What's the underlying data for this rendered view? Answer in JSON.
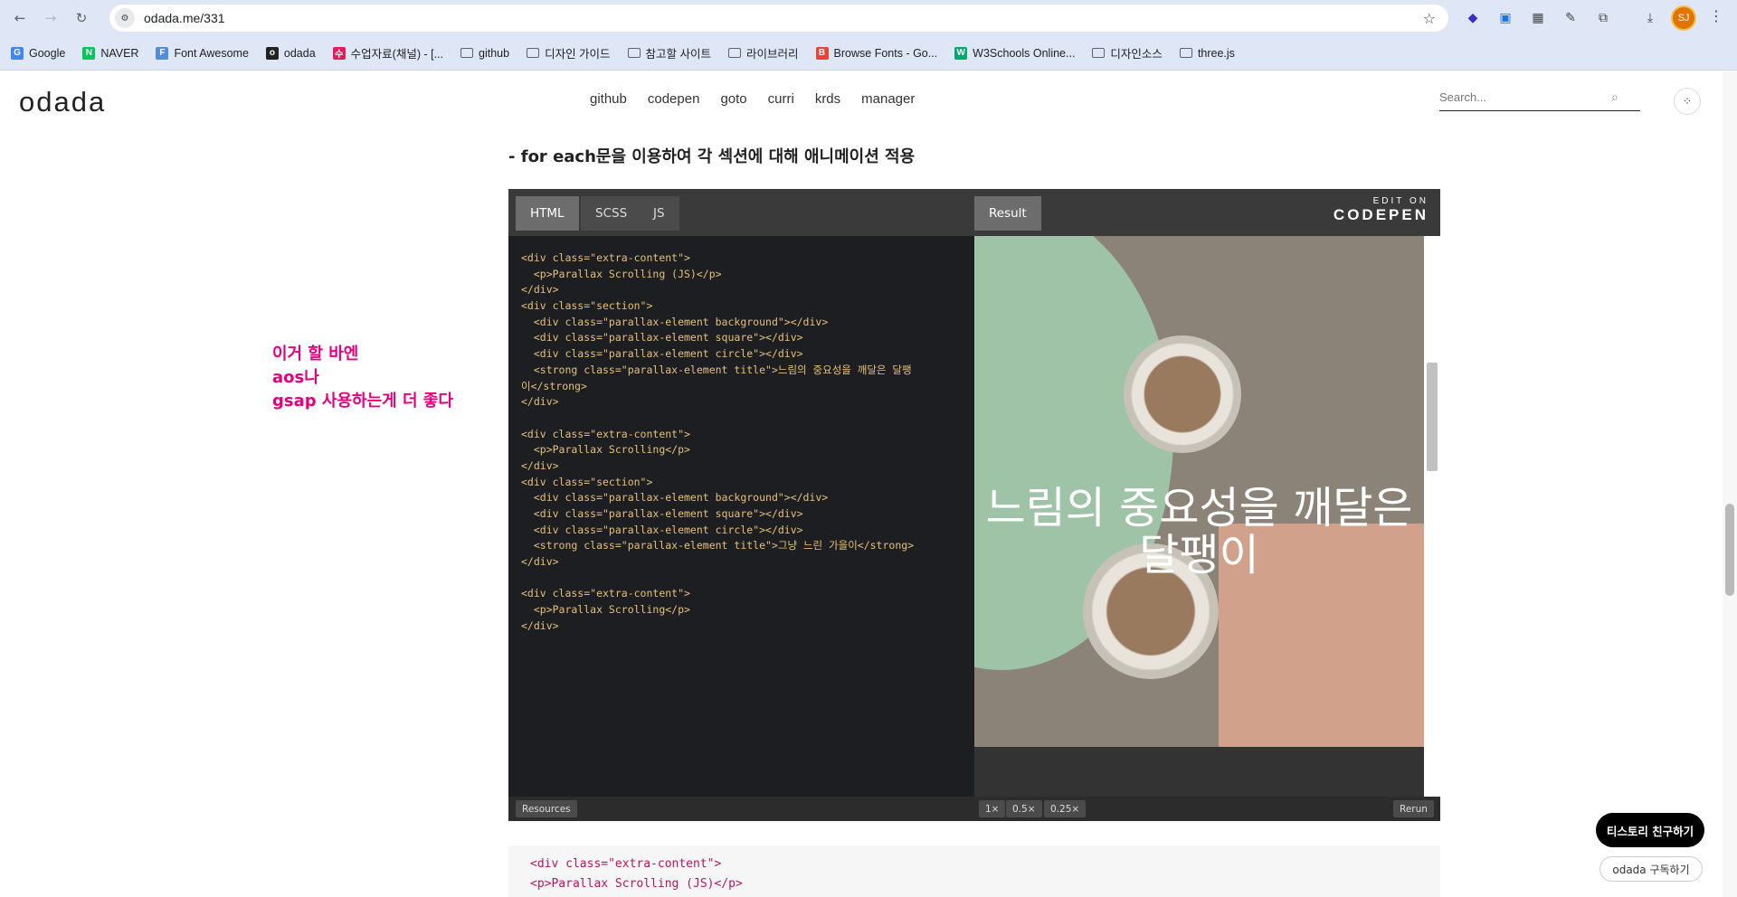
{
  "browser": {
    "url": "odada.me/331",
    "avatar_initials": "SJ",
    "bookmarks": [
      {
        "label": "Google",
        "icon": "google-icon",
        "color": "#4285f4"
      },
      {
        "label": "NAVER",
        "icon": "naver-icon",
        "color": "#03c75a"
      },
      {
        "label": "Font Awesome",
        "icon": "fontawesome-icon",
        "color": "#538dd7"
      },
      {
        "label": "odada",
        "icon": "odada-icon",
        "color": "#222222"
      },
      {
        "label": "수업자료(채널) - [...",
        "icon": "slack-icon",
        "color": "#e01e5a"
      },
      {
        "label": "github",
        "icon": "folder-icon"
      },
      {
        "label": "디자인 가이드",
        "icon": "folder-icon"
      },
      {
        "label": "참고할 사이트",
        "icon": "folder-icon"
      },
      {
        "label": "라이브러리",
        "icon": "folder-icon"
      },
      {
        "label": "Browse Fonts - Go...",
        "icon": "google-fonts-icon",
        "color": "#ea4335"
      },
      {
        "label": "W3Schools Online...",
        "icon": "w3schools-icon",
        "color": "#04aa6d"
      },
      {
        "label": "디자인소스",
        "icon": "folder-icon"
      },
      {
        "label": "three.js",
        "icon": "folder-icon"
      }
    ]
  },
  "site": {
    "logo": "odada",
    "nav": [
      "github",
      "codepen",
      "goto",
      "curri",
      "krds",
      "manager"
    ],
    "search_placeholder": "Search..."
  },
  "post": {
    "heading": "- for each문을 이용하여 각 섹션에 대해 애니메이션 적용",
    "note_lines": [
      "이거 할 바엔",
      "aos나",
      "gsap 사용하는게 더 좋다"
    ],
    "code_below_line1": "<div class=\"extra-content\">",
    "code_below_line2": "    <p>Parallax Scrolling (JS)</p>"
  },
  "codepen": {
    "tabs": [
      "HTML",
      "SCSS",
      "JS"
    ],
    "result_tab": "Result",
    "edit_on_small": "EDIT ON",
    "edit_on_brand": "CODEPEN",
    "code_lines": [
      "<div class=\"extra-content\">",
      "  <p>Parallax Scrolling (JS)</p>",
      "</div>",
      "<div class=\"section\">",
      "  <div class=\"parallax-element background\"></div>",
      "  <div class=\"parallax-element square\"></div>",
      "  <div class=\"parallax-element circle\"></div>",
      "  <strong class=\"parallax-element title\">느림의 중요성을 깨달은 달팽",
      "이</strong>",
      "</div>",
      "",
      "<div class=\"extra-content\">",
      "  <p>Parallax Scrolling</p>",
      "</div>",
      "<div class=\"section\">",
      "  <div class=\"parallax-element background\"></div>",
      "  <div class=\"parallax-element square\"></div>",
      "  <div class=\"parallax-element circle\"></div>",
      "  <strong class=\"parallax-element title\">그냥 느린 가을이</strong>",
      "</div>",
      "",
      "<div class=\"extra-content\">",
      "  <p>Parallax Scrolling</p>",
      "</div>"
    ],
    "result_title": "느림의 중요성을 깨달은 달팽이",
    "footer": {
      "resources": "Resources",
      "zoom_options": [
        "1×",
        "0.5×",
        "0.25×"
      ],
      "rerun": "Rerun"
    }
  },
  "floating": {
    "friend_button": "티스토리 친구하기",
    "subscribe_button": "odada 구독하기"
  },
  "colors": {
    "note": "#e6007e",
    "codepen_bg": "#1d1e22",
    "result_green": "#9ec3a7",
    "result_pink": "#d2a18b"
  }
}
